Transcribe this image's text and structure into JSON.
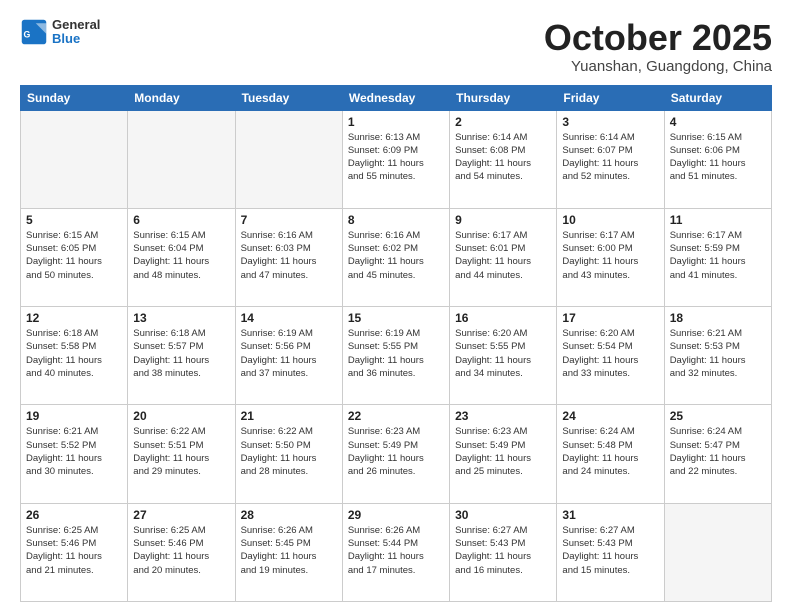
{
  "header": {
    "logo_general": "General",
    "logo_blue": "Blue",
    "month_title": "October 2025",
    "location": "Yuanshan, Guangdong, China"
  },
  "weekdays": [
    "Sunday",
    "Monday",
    "Tuesday",
    "Wednesday",
    "Thursday",
    "Friday",
    "Saturday"
  ],
  "weeks": [
    [
      {
        "day": "",
        "info": ""
      },
      {
        "day": "",
        "info": ""
      },
      {
        "day": "",
        "info": ""
      },
      {
        "day": "1",
        "info": "Sunrise: 6:13 AM\nSunset: 6:09 PM\nDaylight: 11 hours\nand 55 minutes."
      },
      {
        "day": "2",
        "info": "Sunrise: 6:14 AM\nSunset: 6:08 PM\nDaylight: 11 hours\nand 54 minutes."
      },
      {
        "day": "3",
        "info": "Sunrise: 6:14 AM\nSunset: 6:07 PM\nDaylight: 11 hours\nand 52 minutes."
      },
      {
        "day": "4",
        "info": "Sunrise: 6:15 AM\nSunset: 6:06 PM\nDaylight: 11 hours\nand 51 minutes."
      }
    ],
    [
      {
        "day": "5",
        "info": "Sunrise: 6:15 AM\nSunset: 6:05 PM\nDaylight: 11 hours\nand 50 minutes."
      },
      {
        "day": "6",
        "info": "Sunrise: 6:15 AM\nSunset: 6:04 PM\nDaylight: 11 hours\nand 48 minutes."
      },
      {
        "day": "7",
        "info": "Sunrise: 6:16 AM\nSunset: 6:03 PM\nDaylight: 11 hours\nand 47 minutes."
      },
      {
        "day": "8",
        "info": "Sunrise: 6:16 AM\nSunset: 6:02 PM\nDaylight: 11 hours\nand 45 minutes."
      },
      {
        "day": "9",
        "info": "Sunrise: 6:17 AM\nSunset: 6:01 PM\nDaylight: 11 hours\nand 44 minutes."
      },
      {
        "day": "10",
        "info": "Sunrise: 6:17 AM\nSunset: 6:00 PM\nDaylight: 11 hours\nand 43 minutes."
      },
      {
        "day": "11",
        "info": "Sunrise: 6:17 AM\nSunset: 5:59 PM\nDaylight: 11 hours\nand 41 minutes."
      }
    ],
    [
      {
        "day": "12",
        "info": "Sunrise: 6:18 AM\nSunset: 5:58 PM\nDaylight: 11 hours\nand 40 minutes."
      },
      {
        "day": "13",
        "info": "Sunrise: 6:18 AM\nSunset: 5:57 PM\nDaylight: 11 hours\nand 38 minutes."
      },
      {
        "day": "14",
        "info": "Sunrise: 6:19 AM\nSunset: 5:56 PM\nDaylight: 11 hours\nand 37 minutes."
      },
      {
        "day": "15",
        "info": "Sunrise: 6:19 AM\nSunset: 5:55 PM\nDaylight: 11 hours\nand 36 minutes."
      },
      {
        "day": "16",
        "info": "Sunrise: 6:20 AM\nSunset: 5:55 PM\nDaylight: 11 hours\nand 34 minutes."
      },
      {
        "day": "17",
        "info": "Sunrise: 6:20 AM\nSunset: 5:54 PM\nDaylight: 11 hours\nand 33 minutes."
      },
      {
        "day": "18",
        "info": "Sunrise: 6:21 AM\nSunset: 5:53 PM\nDaylight: 11 hours\nand 32 minutes."
      }
    ],
    [
      {
        "day": "19",
        "info": "Sunrise: 6:21 AM\nSunset: 5:52 PM\nDaylight: 11 hours\nand 30 minutes."
      },
      {
        "day": "20",
        "info": "Sunrise: 6:22 AM\nSunset: 5:51 PM\nDaylight: 11 hours\nand 29 minutes."
      },
      {
        "day": "21",
        "info": "Sunrise: 6:22 AM\nSunset: 5:50 PM\nDaylight: 11 hours\nand 28 minutes."
      },
      {
        "day": "22",
        "info": "Sunrise: 6:23 AM\nSunset: 5:49 PM\nDaylight: 11 hours\nand 26 minutes."
      },
      {
        "day": "23",
        "info": "Sunrise: 6:23 AM\nSunset: 5:49 PM\nDaylight: 11 hours\nand 25 minutes."
      },
      {
        "day": "24",
        "info": "Sunrise: 6:24 AM\nSunset: 5:48 PM\nDaylight: 11 hours\nand 24 minutes."
      },
      {
        "day": "25",
        "info": "Sunrise: 6:24 AM\nSunset: 5:47 PM\nDaylight: 11 hours\nand 22 minutes."
      }
    ],
    [
      {
        "day": "26",
        "info": "Sunrise: 6:25 AM\nSunset: 5:46 PM\nDaylight: 11 hours\nand 21 minutes."
      },
      {
        "day": "27",
        "info": "Sunrise: 6:25 AM\nSunset: 5:46 PM\nDaylight: 11 hours\nand 20 minutes."
      },
      {
        "day": "28",
        "info": "Sunrise: 6:26 AM\nSunset: 5:45 PM\nDaylight: 11 hours\nand 19 minutes."
      },
      {
        "day": "29",
        "info": "Sunrise: 6:26 AM\nSunset: 5:44 PM\nDaylight: 11 hours\nand 17 minutes."
      },
      {
        "day": "30",
        "info": "Sunrise: 6:27 AM\nSunset: 5:43 PM\nDaylight: 11 hours\nand 16 minutes."
      },
      {
        "day": "31",
        "info": "Sunrise: 6:27 AM\nSunset: 5:43 PM\nDaylight: 11 hours\nand 15 minutes."
      },
      {
        "day": "",
        "info": ""
      }
    ]
  ]
}
